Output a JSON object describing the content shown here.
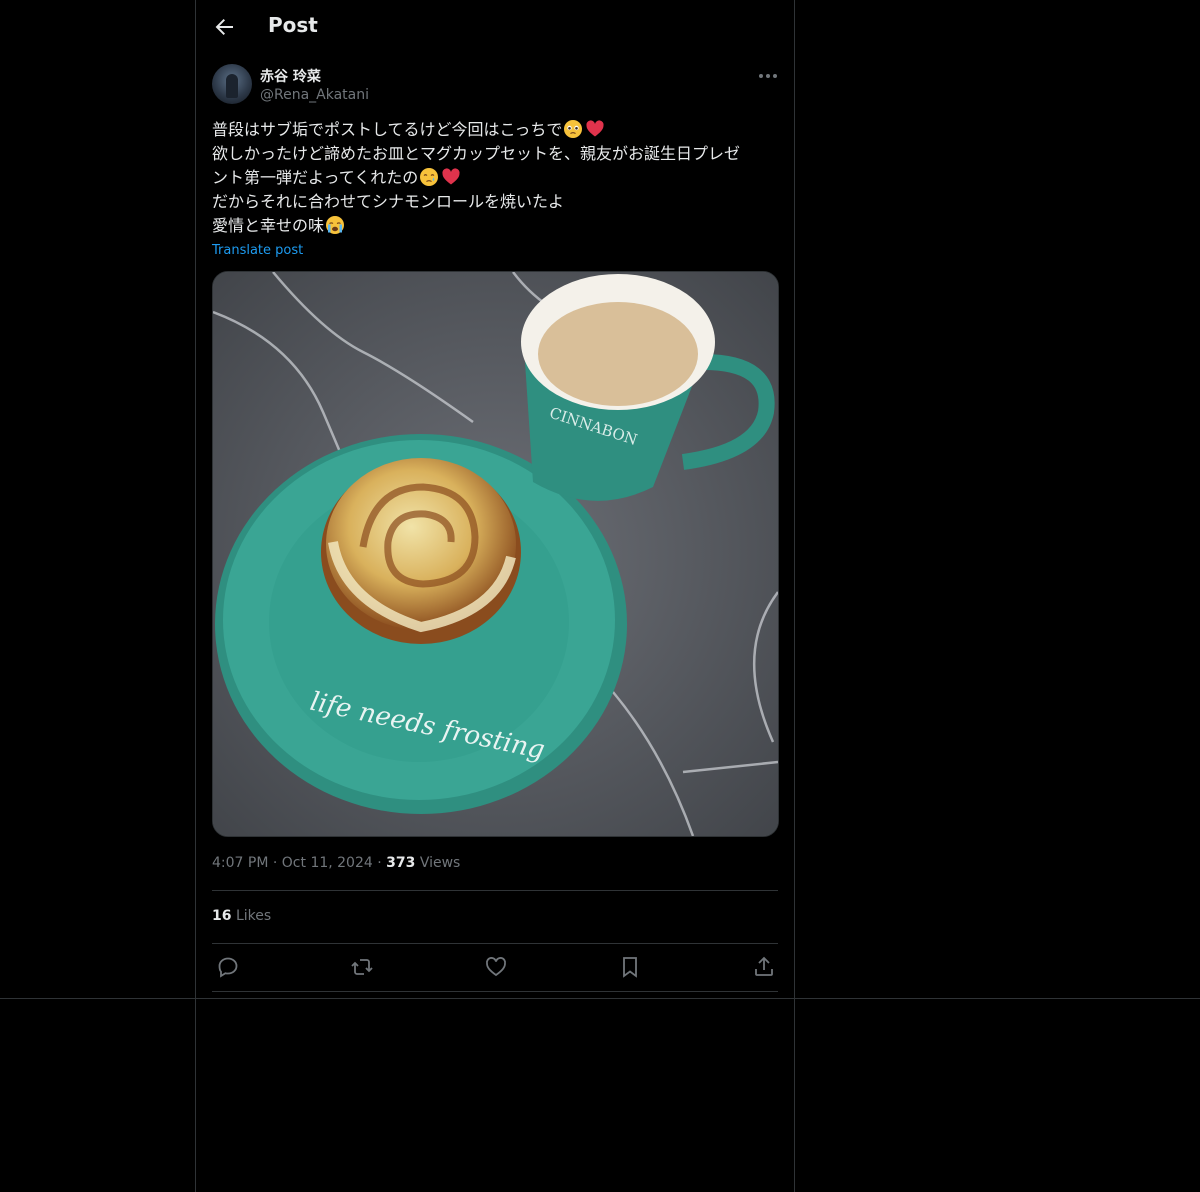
{
  "header": {
    "title": "Post"
  },
  "author": {
    "name": "赤谷 玲菜",
    "handle": "@Rena_Akatani"
  },
  "post": {
    "lines": [
      "普段はサブ垢でポストしてるけど今回はこっちで",
      "欲しかったけど諦めたお皿とマグカップセットを、親友がお誕生日プレゼ",
      "ント第一弾だよってくれたの",
      "だからそれに合わせてシナモンロールを焼いたよ",
      "愛情と幸せの味"
    ],
    "translate_label": "Translate post",
    "image": {
      "mug_text": "CINNABON",
      "plate_text": "life needs frosting"
    }
  },
  "meta": {
    "time": "4:07 PM",
    "date": "Oct 11, 2024",
    "views_count": "373",
    "views_label": "Views"
  },
  "stats": {
    "likes_count": "16",
    "likes_label": "Likes"
  },
  "icons": [
    "back-arrow-icon",
    "more-icon",
    "reply-icon",
    "repost-icon",
    "like-icon",
    "bookmark-icon",
    "share-icon"
  ],
  "colors": {
    "accent": "#1d9bf0",
    "text": "#e7e9ea",
    "muted": "#71767b",
    "border": "#2f3336",
    "plate": "#3aa594"
  }
}
